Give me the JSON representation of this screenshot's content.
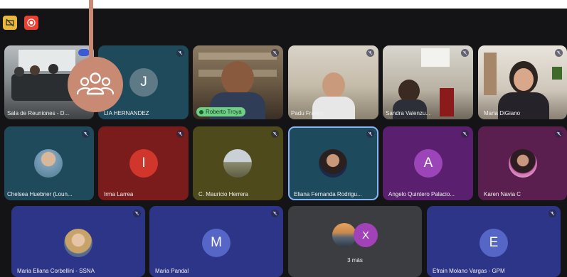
{
  "top_bar": {
    "icons": [
      "screen-off-icon",
      "record-icon"
    ]
  },
  "tiles": [
    {
      "name": "Sala de Reuniones - D...",
      "kind": "video-room"
    },
    {
      "name": "LIA HERNANDEZ",
      "kind": "letter",
      "letter": "J"
    },
    {
      "name": "Roberto Troya",
      "kind": "video-person",
      "speaking": true
    },
    {
      "name": "Padu Franco",
      "kind": "video-person"
    },
    {
      "name": "Sandra Valenzu...",
      "kind": "video-person"
    },
    {
      "name": "Maria DiGiano",
      "kind": "video-person"
    },
    {
      "name": "Chelsea Huebner (Loun...",
      "kind": "photo"
    },
    {
      "name": "Irma Larrea",
      "kind": "letter",
      "letter": "I"
    },
    {
      "name": "C. Mauricio Herrera",
      "kind": "photo"
    },
    {
      "name": "Eliana Fernanda Rodrigu...",
      "kind": "photo"
    },
    {
      "name": "Angelo Quintero Palacio...",
      "kind": "letter",
      "letter": "A"
    },
    {
      "name": "Karen Navia C",
      "kind": "photo"
    },
    {
      "name": "Maria Eliana Corbellini - SSNA",
      "kind": "photo"
    },
    {
      "name": "Maria Pandal",
      "kind": "letter",
      "letter": "M"
    },
    {
      "name": "3 más",
      "kind": "more",
      "letter": "X"
    },
    {
      "name": "Efrain Molano Vargas - GPM",
      "kind": "letter",
      "letter": "E"
    }
  ],
  "overlay": {
    "icon": "people-icon"
  }
}
